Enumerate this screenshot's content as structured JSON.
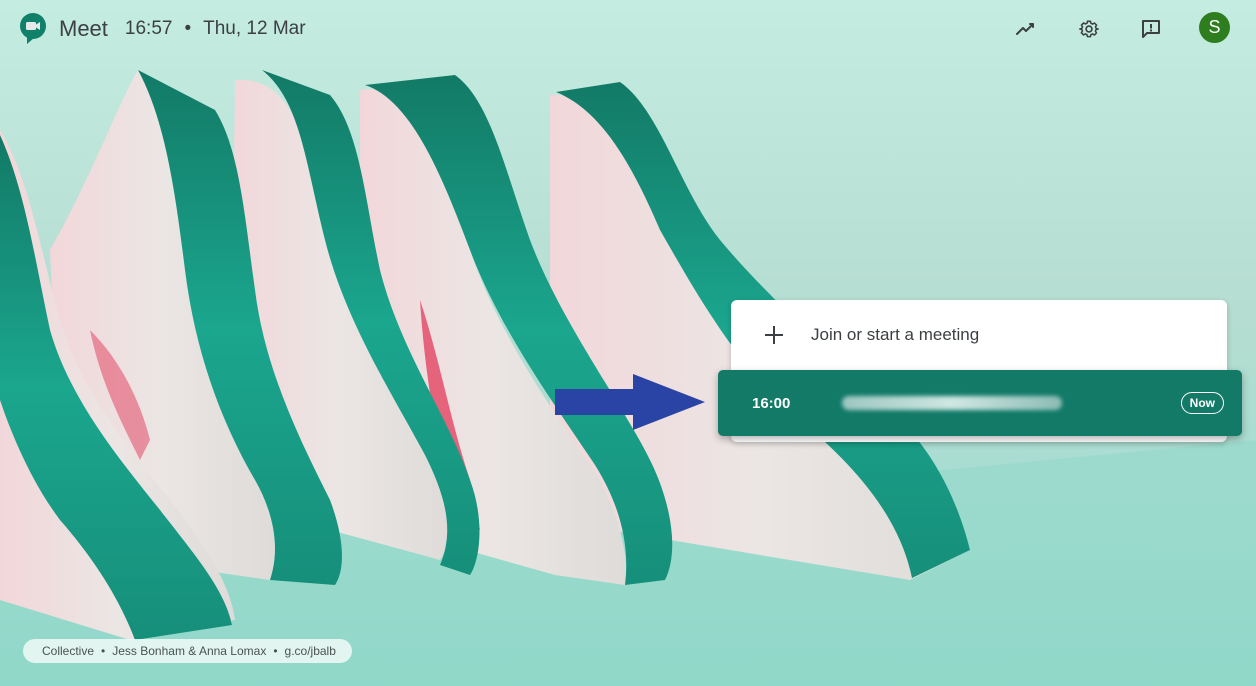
{
  "header": {
    "app_name": "Meet",
    "time": "16:57",
    "separator": "•",
    "date": "Thu, 12 Mar",
    "icons": [
      "activity-trend-icon",
      "settings-gear-icon",
      "feedback-icon"
    ],
    "avatar_initial": "S",
    "avatar_color": "#2e7d1e"
  },
  "card": {
    "join_label": "Join or start a meeting",
    "meeting": {
      "time": "16:00",
      "title": "(blurred meeting name)",
      "badge": "Now",
      "color": "#137a68"
    }
  },
  "annotation": {
    "arrow_color": "#2a44a6"
  },
  "credit": {
    "collection": "Collective",
    "artists": "Jess Bonham & Anna Lomax",
    "link": "g.co/jbalb",
    "separator": "•"
  },
  "colors": {
    "background": "#b9e2d6",
    "teal": "#1a9a84",
    "paper_white": "#e9e6e4",
    "accent_red": "#e23a5a"
  }
}
